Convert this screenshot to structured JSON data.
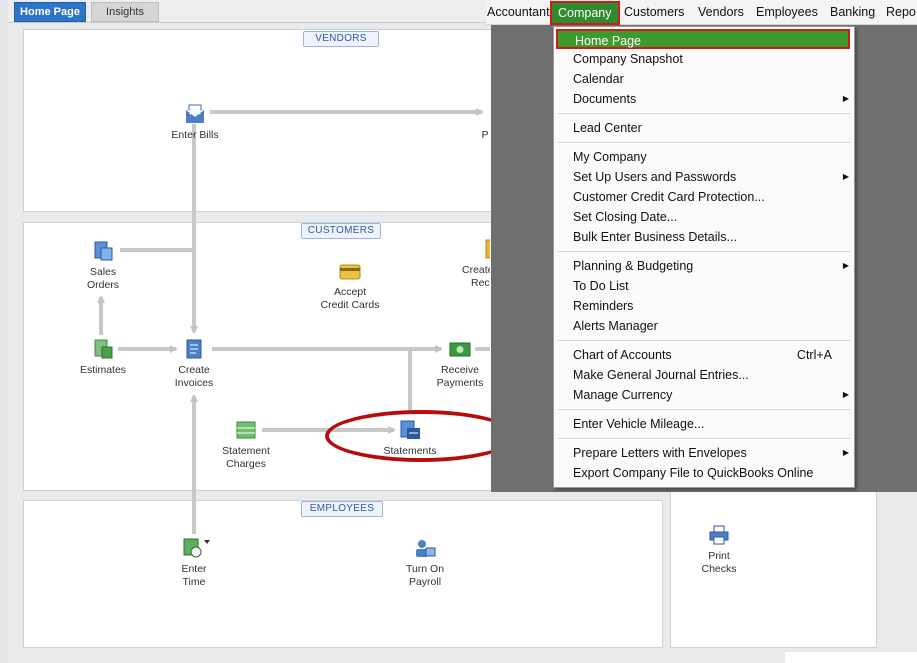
{
  "tabs": {
    "home_page": "Home Page",
    "insights": "Insights"
  },
  "sections": {
    "vendors": "VENDORS",
    "customers": "CUSTOMERS",
    "employees": "EMPLOYEES"
  },
  "nodes": {
    "enter_bills": "Enter Bills",
    "pay_bills_partial": "P",
    "sales_orders_1": "Sales",
    "sales_orders_2": "Orders",
    "create_sales_receipts_1": "Create",
    "create_sales_receipts_2": "Rec",
    "accept_cc_1": "Accept",
    "accept_cc_2": "Credit Cards",
    "estimates": "Estimates",
    "create_invoices_1": "Create",
    "create_invoices_2": "Invoices",
    "receive_payments_1": "Receive",
    "receive_payments_2": "Payments",
    "statement_charges_1": "Statement",
    "statement_charges_2": "Charges",
    "statements": "Statements",
    "enter_time_1": "Enter",
    "enter_time_2": "Time",
    "turn_on_payroll_1": "Turn On",
    "turn_on_payroll_2": "Payroll",
    "print_checks_1": "Print",
    "print_checks_2": "Checks"
  },
  "menubar": {
    "accountant": "Accountant",
    "company": "Company",
    "customers": "Customers",
    "vendors": "Vendors",
    "employees": "Employees",
    "banking": "Banking",
    "reports_partial": "Repo"
  },
  "company_menu": {
    "home_page": "Home Page",
    "company_snapshot": "Company Snapshot",
    "calendar": "Calendar",
    "documents": "Documents",
    "lead_center": "Lead Center",
    "my_company": "My Company",
    "set_up_users": "Set Up Users and Passwords",
    "cc_protection": "Customer Credit Card Protection...",
    "set_closing_date": "Set Closing Date...",
    "bulk_enter": "Bulk Enter Business Details...",
    "planning_budgeting": "Planning & Budgeting",
    "to_do_list": "To Do List",
    "reminders": "Reminders",
    "alerts_manager": "Alerts Manager",
    "chart_of_accounts": "Chart of Accounts",
    "chart_of_accounts_shortcut": "Ctrl+A",
    "general_journal": "Make General Journal Entries...",
    "manage_currency": "Manage Currency",
    "vehicle_mileage": "Enter Vehicle Mileage...",
    "prepare_letters": "Prepare Letters with Envelopes",
    "export_qbo": "Export Company File to QuickBooks Online"
  },
  "colors": {
    "menu_highlight": "#3d9b2d",
    "annotation_red": "#d11a1a",
    "tab_blue": "#2f75c7"
  }
}
